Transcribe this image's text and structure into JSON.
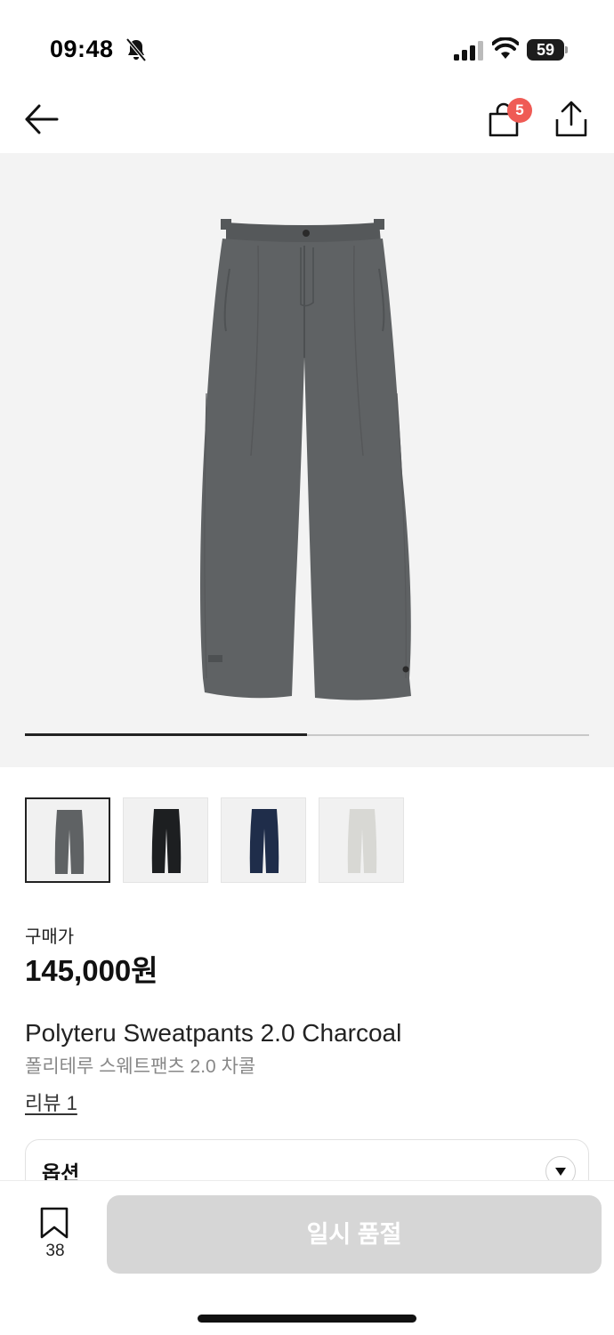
{
  "status_bar": {
    "time": "09:48",
    "battery": "59",
    "icons": [
      "bell-off-icon",
      "cellular-signal-icon",
      "wifi-icon",
      "battery-icon"
    ]
  },
  "nav": {
    "back_icon": "arrow-left-icon",
    "bag_icon": "shopping-bag-icon",
    "bag_count": "5",
    "share_icon": "share-upload-icon",
    "badge_color": "#ef5b55"
  },
  "gallery": {
    "product_color": "#5f6264",
    "progress_fraction": 0.5
  },
  "thumbnails": [
    {
      "color_name": "charcoal",
      "swatch": "#5f6264",
      "selected": true
    },
    {
      "color_name": "black",
      "swatch": "#1d1f21",
      "selected": false
    },
    {
      "color_name": "navy",
      "swatch": "#1f2d4a",
      "selected": false
    },
    {
      "color_name": "light gray",
      "swatch": "#d8d8d4",
      "selected": false
    }
  ],
  "product": {
    "price_label": "구매가",
    "price": "145,000원",
    "title_en": "Polyteru Sweatpants 2.0 Charcoal",
    "title_ko": "폴리테루 스웨트팬츠 2.0 차콜",
    "review_link": "리뷰 1"
  },
  "options": {
    "label": "옵션"
  },
  "bottom_bar": {
    "bookmark_count": "38",
    "soldout_label": "일시 품절",
    "button_color": "#d6d6d6"
  }
}
